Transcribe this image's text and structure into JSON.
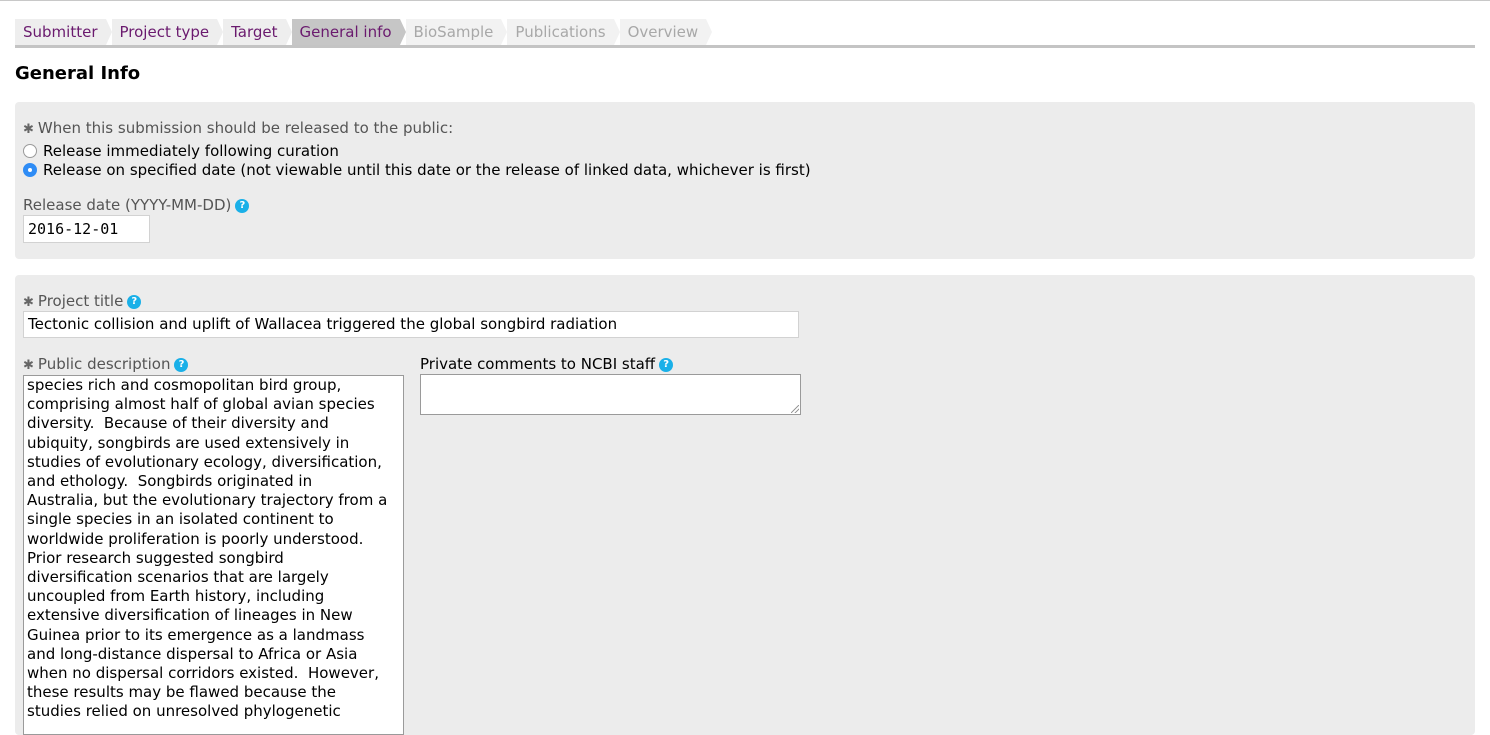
{
  "steps": [
    {
      "label": "Submitter",
      "state": "done"
    },
    {
      "label": "Project type",
      "state": "done"
    },
    {
      "label": "Target",
      "state": "done"
    },
    {
      "label": "General info",
      "state": "active"
    },
    {
      "label": "BioSample",
      "state": "disabled"
    },
    {
      "label": "Publications",
      "state": "disabled"
    },
    {
      "label": "Overview",
      "state": "disabled"
    }
  ],
  "page": {
    "title": "General Info"
  },
  "release": {
    "question": "When this submission should be released to the public:",
    "option_immediate": "Release immediately following curation",
    "option_date": "Release on specified date (not viewable until this date or the release of linked data, whichever is first)",
    "selected": "date",
    "date_label": "Release date (YYYY-MM-DD)",
    "date_value": "2016-12-01"
  },
  "project": {
    "title_label": "Project title",
    "title_value": "Tectonic collision and uplift of Wallacea triggered the global songbird radiation",
    "description_label": "Public description",
    "description_value": "species rich and cosmopolitan bird group,\ncomprising almost half of global avian species\ndiversity.  Because of their diversity and\nubiquity, songbirds are used extensively in\nstudies of evolutionary ecology, diversification,\nand ethology.  Songbirds originated in\nAustralia, but the evolutionary trajectory from a\nsingle species in an isolated continent to\nworldwide proliferation is poorly understood.\nPrior research suggested songbird\ndiversification scenarios that are largely\nuncoupled from Earth history, including\nextensive diversification of lineages in New\nGuinea prior to its emergence as a landmass\nand long-distance dispersal to Africa or Asia\nwhen no dispersal corridors existed.  However,\nthese results may be flawed because the\nstudies relied on unresolved phylogenetic",
    "comments_label": "Private comments to NCBI staff",
    "comments_value": ""
  },
  "icons": {
    "help": "question-mark-icon",
    "required": "asterisk-icon"
  },
  "colors": {
    "step_text": "#6a1a6e",
    "help": "#1ab0e8",
    "radio_selected": "#2f8cf5",
    "panel": "#ececec"
  }
}
